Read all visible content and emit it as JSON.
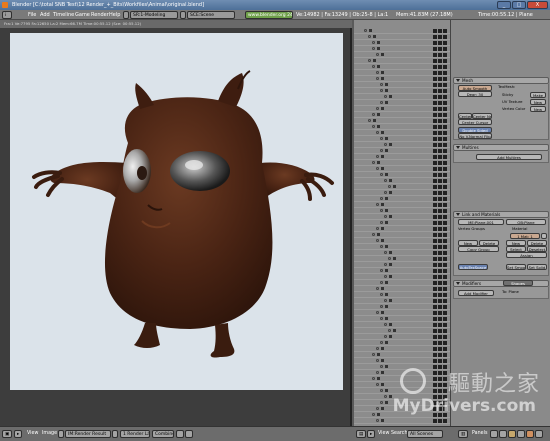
{
  "window": {
    "title": "Blender [C:\\total SNB Test\\12 Render_+_Bits\\Workfiles\\Animal\\original.blend]",
    "minimize": "_",
    "maximize": "□",
    "close": "X"
  },
  "menubar": {
    "items": [
      "File",
      "Add",
      "Timeline",
      "Game",
      "Render",
      "Help"
    ],
    "screen_selector": "SR:1-Modeling",
    "scene_selector": "SCE:Scene",
    "url": "www.blender.org 245",
    "stats": "Ve:14982 | Fa:13249 | Ob:25-8 | La:1",
    "mem": "Mem:41.83M (27.18M)",
    "time": "Time:00:55.12 | Plane"
  },
  "viewport": {
    "render_status": "Fra:1  Ve:7795 Fa:12650  La:2  Mem:66.7M  Time:00:55.12 (Sce: 00:55.12)"
  },
  "panels": {
    "mesh": {
      "header": "Mesh",
      "auto_smooth": "Auto Smooth",
      "degr": "Degr: 30",
      "texmesh": "TexMesh:",
      "sticky": "Sticky",
      "make": "Make",
      "uv_texture": "UV Texture",
      "new": "New",
      "vertex_color": "Vertex Color",
      "new2": "New",
      "center": "Center",
      "center_new": "Center New",
      "center_cursor": "Center Cursor",
      "double_sided": "Double Sided",
      "no_v_normal_flip": "No V.Normal Flip"
    },
    "multires": {
      "header": "Multires",
      "add_multires": "Add Multires"
    },
    "link_materials": {
      "header": "Link and Materials",
      "me_field": "ME:Plane.001",
      "ob_field": "OB:Plane",
      "vertex_groups": "Vertex Groups",
      "material": "Material",
      "mat_slot": "1 Mat: 1",
      "new": "New",
      "delete": "Delete",
      "copy_group": "Copy Group",
      "select": "Select",
      "deselect": "Deselect",
      "assign": "Assign",
      "new2": "New",
      "delete2": "Delete",
      "autotexspace": "AutoTexSpace",
      "set_smooth": "Set Smooth",
      "set_solid": "Set Solid"
    },
    "modifiers": {
      "header": "Modifiers",
      "shapes_tab": "Shapes",
      "add_modifier": "Add Modifier",
      "to": "To: Plane"
    }
  },
  "bottombar": {
    "view": "View",
    "image": "Image",
    "image_selector": "IM:Render Result",
    "render_layer": "1 Render Layer",
    "composite": "Combine",
    "view2": "View",
    "search": "Search",
    "all_scenes": "All Scenes",
    "panels": "Panels"
  },
  "watermark": {
    "chinese": "驅動之家",
    "site": "MyDrivers.com"
  },
  "colors": {
    "render_bg": "#dbe3ea",
    "creature": "#4a2414",
    "salmon_button": "#c9a890",
    "blue_button": "#6a82b0"
  }
}
